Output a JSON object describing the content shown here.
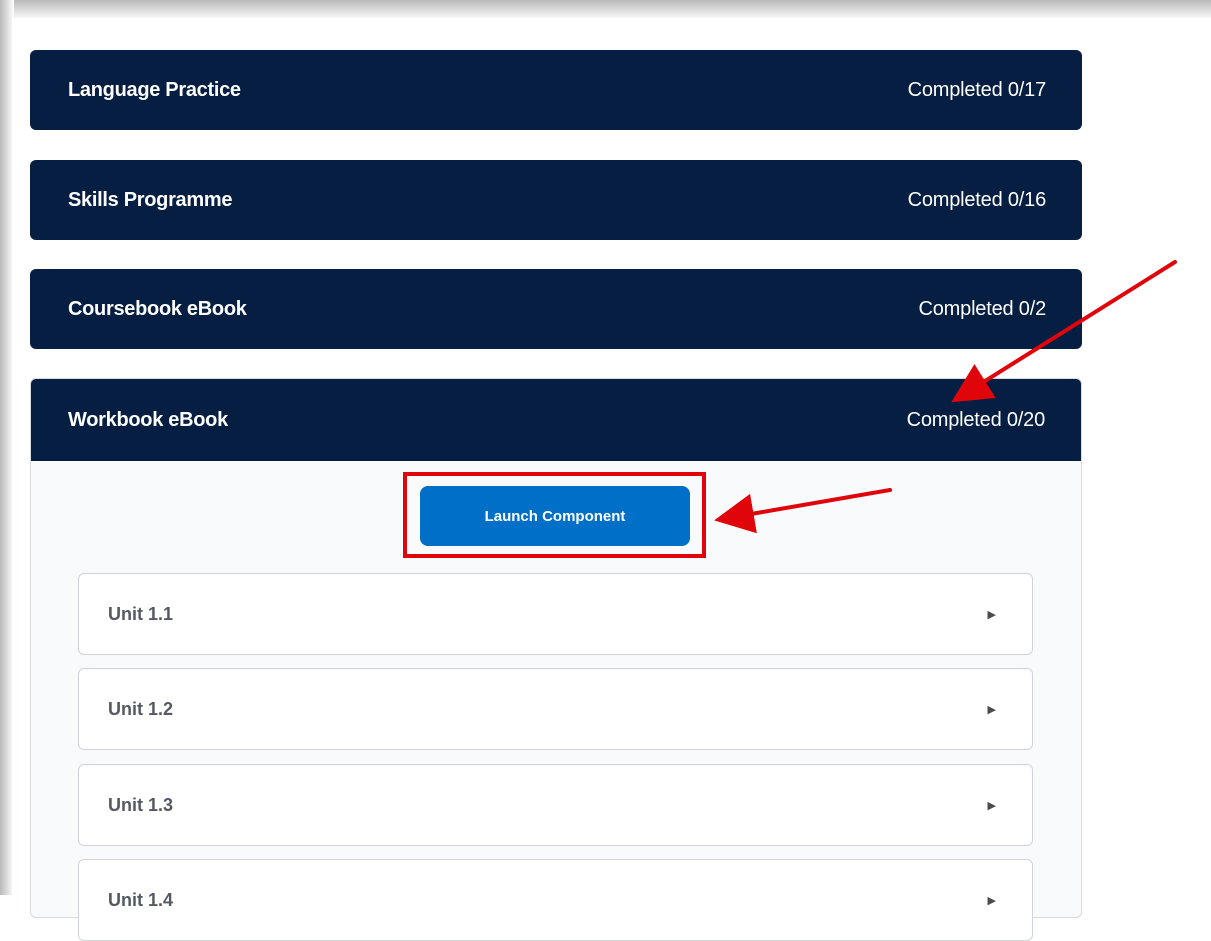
{
  "sections": [
    {
      "title": "Language Practice",
      "status": "Completed 0/17"
    },
    {
      "title": "Skills Programme",
      "status": "Completed 0/16"
    },
    {
      "title": "Coursebook eBook",
      "status": "Completed 0/2"
    },
    {
      "title": "Workbook eBook",
      "status": "Completed 0/20"
    }
  ],
  "expanded": {
    "launch_label": "Launch Component",
    "units": [
      {
        "label": "Unit 1.1"
      },
      {
        "label": "Unit 1.2"
      },
      {
        "label": "Unit 1.3"
      },
      {
        "label": "Unit 1.4"
      }
    ]
  },
  "icons": {
    "unit_expand": "caret-right-icon"
  },
  "colors": {
    "header_bg": "#051e42",
    "button_bg": "#006fc7",
    "annotation_red": "#e0040b"
  }
}
